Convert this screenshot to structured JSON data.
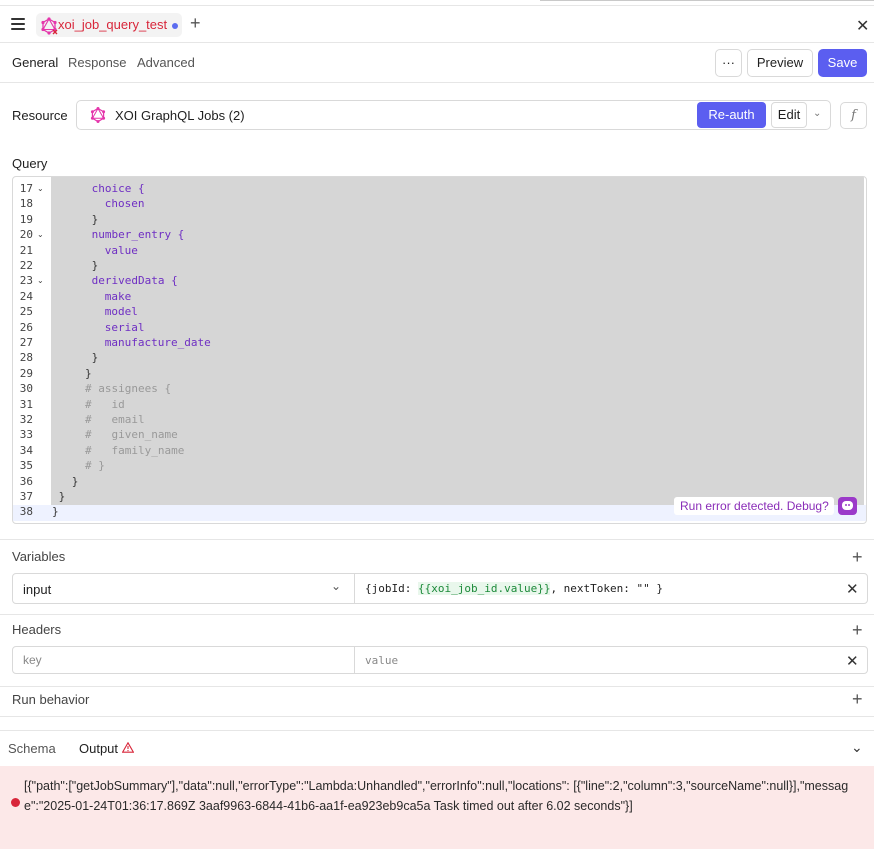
{
  "tab": {
    "title": "xoi_job_query_test"
  },
  "subtabs": [
    "General",
    "Response",
    "Advanced"
  ],
  "toolbar": {
    "more": "···",
    "preview": "Preview",
    "save": "Save"
  },
  "resource": {
    "label": "Resource",
    "name": "XOI GraphQL Jobs (2)",
    "reauth": "Re-auth",
    "edit": "Edit",
    "fx": "f"
  },
  "query": {
    "label": "Query",
    "lines": [
      {
        "n": "17",
        "fold": true,
        "indent": 6,
        "text": "choice {",
        "cls": "kw"
      },
      {
        "n": "18",
        "fold": false,
        "indent": 8,
        "text": "chosen",
        "cls": "kw"
      },
      {
        "n": "19",
        "fold": false,
        "indent": 6,
        "text": "}",
        "cls": "pn"
      },
      {
        "n": "20",
        "fold": true,
        "indent": 6,
        "text": "number_entry {",
        "cls": "kw"
      },
      {
        "n": "21",
        "fold": false,
        "indent": 8,
        "text": "value",
        "cls": "kw"
      },
      {
        "n": "22",
        "fold": false,
        "indent": 6,
        "text": "}",
        "cls": "pn"
      },
      {
        "n": "23",
        "fold": true,
        "indent": 6,
        "text": "derivedData {",
        "cls": "kw"
      },
      {
        "n": "24",
        "fold": false,
        "indent": 8,
        "text": "make",
        "cls": "kw"
      },
      {
        "n": "25",
        "fold": false,
        "indent": 8,
        "text": "model",
        "cls": "kw"
      },
      {
        "n": "26",
        "fold": false,
        "indent": 8,
        "text": "serial",
        "cls": "kw"
      },
      {
        "n": "27",
        "fold": false,
        "indent": 8,
        "text": "manufacture_date",
        "cls": "kw"
      },
      {
        "n": "28",
        "fold": false,
        "indent": 6,
        "text": "}",
        "cls": "pn"
      },
      {
        "n": "29",
        "fold": false,
        "indent": 5,
        "text": "}",
        "cls": "pn"
      },
      {
        "n": "30",
        "fold": false,
        "indent": 5,
        "text": "# assignees {",
        "cls": "cm"
      },
      {
        "n": "31",
        "fold": false,
        "indent": 5,
        "text": "#   id",
        "cls": "cm"
      },
      {
        "n": "32",
        "fold": false,
        "indent": 5,
        "text": "#   email",
        "cls": "cm"
      },
      {
        "n": "33",
        "fold": false,
        "indent": 5,
        "text": "#   given_name",
        "cls": "cm"
      },
      {
        "n": "34",
        "fold": false,
        "indent": 5,
        "text": "#   family_name",
        "cls": "cm"
      },
      {
        "n": "35",
        "fold": false,
        "indent": 5,
        "text": "# }",
        "cls": "cm"
      },
      {
        "n": "36",
        "fold": false,
        "indent": 3,
        "text": "}",
        "cls": "pn"
      },
      {
        "n": "37",
        "fold": false,
        "indent": 1,
        "text": "}",
        "cls": "pn"
      },
      {
        "n": "38",
        "fold": false,
        "indent": 0,
        "text": "}",
        "cls": "pn"
      }
    ],
    "debug_prompt": "Run error detected. Debug?"
  },
  "variables": {
    "label": "Variables",
    "select_value": "input",
    "value_prefix": "{jobId: ",
    "value_template": "{{xoi_job_id.value}}",
    "value_suffix": ", nextToken: \"\" }"
  },
  "headers": {
    "label": "Headers",
    "key_placeholder": "key",
    "value_placeholder": "value"
  },
  "run_behavior": {
    "label": "Run behavior"
  },
  "bottom": {
    "schema": "Schema",
    "output": "Output"
  },
  "error": {
    "text": "[{\"path\":[\"getJobSummary\"],\"data\":null,\"errorType\":\"Lambda:Unhandled\",\"errorInfo\":null,\"locations\": [{\"line\":2,\"column\":3,\"sourceName\":null}],\"message\":\"2025-01-24T01:36:17.869Z 3aaf9963-6844-41b6-aa1f-ea923eb9ca5a Task timed out after 6.02 seconds\"}]"
  },
  "colors": {
    "accent": "#5b5ef0",
    "error_bg": "#fce8e8",
    "tab_title": "#d8263a",
    "keyword": "#6f2fc3"
  }
}
